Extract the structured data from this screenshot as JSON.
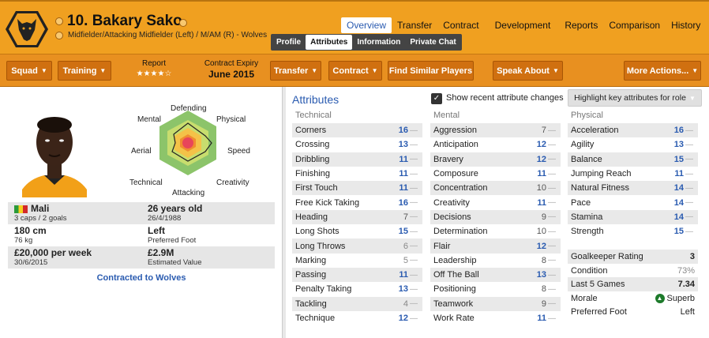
{
  "player": {
    "name": "10. Bakary Sako",
    "position": "Midfielder/Attacking Midfielder (Left) / M/AM (R) - Wolves"
  },
  "top_tabs": [
    "Overview",
    "Transfer",
    "Contract",
    "Development",
    "Reports",
    "Comparison",
    "History"
  ],
  "sub_tabs": [
    "Profile",
    "Attributes",
    "Information",
    "Private Chat"
  ],
  "toolbar": {
    "squad": "Squad",
    "training": "Training",
    "report_label": "Report",
    "report_stars": "★★★★☆",
    "contract_label": "Contract Expiry",
    "contract_value": "June 2015",
    "transfer": "Transfer",
    "contract": "Contract",
    "find_similar": "Find Similar Players",
    "speak_about": "Speak About",
    "more_actions": "More Actions..."
  },
  "radar_labels": {
    "defending": "Defending",
    "physical": "Physical",
    "speed": "Speed",
    "creativity": "Creativity",
    "attacking": "Attacking",
    "technical": "Technical",
    "aerial": "Aerial",
    "mental": "Mental"
  },
  "info": {
    "nation": "Mali",
    "caps": "3 caps / 2 goals",
    "age": "26 years old",
    "dob": "26/4/1988",
    "height": "180 cm",
    "weight": "76 kg",
    "foot": "Left",
    "foot_label": "Preferred Foot",
    "wage": "£20,000 per week",
    "wage_date": "30/6/2015",
    "value": "£2.9M",
    "value_label": "Estimated Value",
    "contracted": "Contracted to Wolves"
  },
  "attributes_panel": {
    "title": "Attributes",
    "show_changes": "Show recent attribute changes",
    "highlight": "Highlight key attributes for role"
  },
  "technical": {
    "heading": "Technical",
    "items": [
      {
        "name": "Corners",
        "value": "16"
      },
      {
        "name": "Crossing",
        "value": "13"
      },
      {
        "name": "Dribbling",
        "value": "11"
      },
      {
        "name": "Finishing",
        "value": "11"
      },
      {
        "name": "First Touch",
        "value": "11"
      },
      {
        "name": "Free Kick Taking",
        "value": "16"
      },
      {
        "name": "Heading",
        "value": "7"
      },
      {
        "name": "Long Shots",
        "value": "15"
      },
      {
        "name": "Long Throws",
        "value": "6"
      },
      {
        "name": "Marking",
        "value": "5"
      },
      {
        "name": "Passing",
        "value": "11"
      },
      {
        "name": "Penalty Taking",
        "value": "13"
      },
      {
        "name": "Tackling",
        "value": "4"
      },
      {
        "name": "Technique",
        "value": "12"
      }
    ]
  },
  "mental": {
    "heading": "Mental",
    "items": [
      {
        "name": "Aggression",
        "value": "7"
      },
      {
        "name": "Anticipation",
        "value": "12"
      },
      {
        "name": "Bravery",
        "value": "12"
      },
      {
        "name": "Composure",
        "value": "11"
      },
      {
        "name": "Concentration",
        "value": "10"
      },
      {
        "name": "Creativity",
        "value": "11"
      },
      {
        "name": "Decisions",
        "value": "9"
      },
      {
        "name": "Determination",
        "value": "10"
      },
      {
        "name": "Flair",
        "value": "12"
      },
      {
        "name": "Leadership",
        "value": "8"
      },
      {
        "name": "Off The Ball",
        "value": "13"
      },
      {
        "name": "Positioning",
        "value": "8"
      },
      {
        "name": "Teamwork",
        "value": "9"
      },
      {
        "name": "Work Rate",
        "value": "11"
      }
    ]
  },
  "physical": {
    "heading": "Physical",
    "items": [
      {
        "name": "Acceleration",
        "value": "16"
      },
      {
        "name": "Agility",
        "value": "13"
      },
      {
        "name": "Balance",
        "value": "15"
      },
      {
        "name": "Jumping Reach",
        "value": "11"
      },
      {
        "name": "Natural Fitness",
        "value": "14"
      },
      {
        "name": "Pace",
        "value": "14"
      },
      {
        "name": "Stamina",
        "value": "14"
      },
      {
        "name": "Strength",
        "value": "15"
      }
    ]
  },
  "extra": {
    "gk_label": "Goalkeeper Rating",
    "gk_value": "3",
    "cond_label": "Condition",
    "cond_value": "73%",
    "last5_label": "Last 5 Games",
    "last5_value": "7.34",
    "morale_label": "Morale",
    "morale_value": "Superb",
    "pf_label": "Preferred Foot",
    "pf_value": "Left"
  },
  "colors": {
    "accent": "#f0a020",
    "link_blue": "#2a5bb0",
    "button": "#d07010"
  }
}
